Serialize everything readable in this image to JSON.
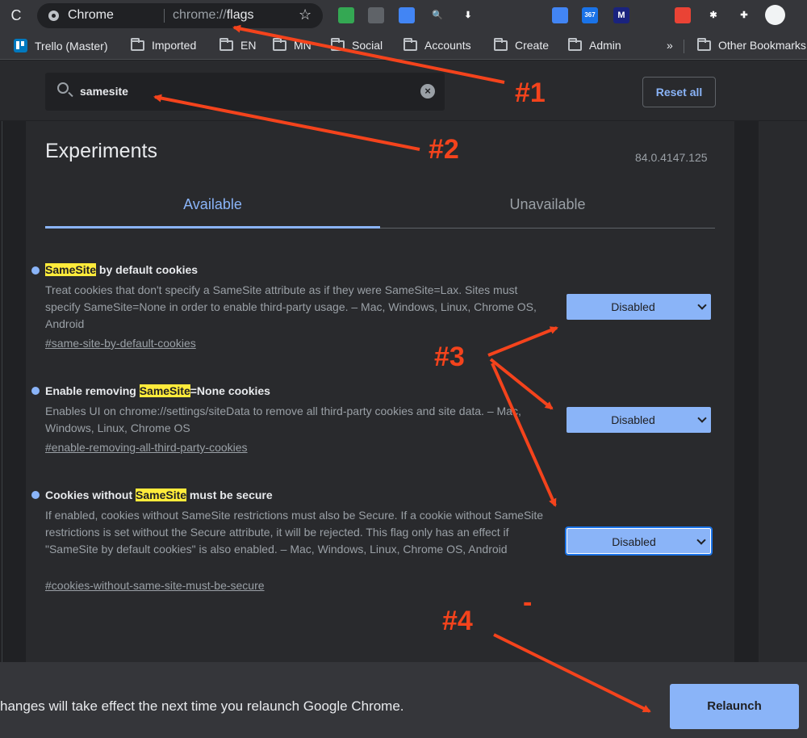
{
  "toolbar": {
    "reload_glyph": "C",
    "site_label": "Chrome",
    "url_prefix": "chrome://",
    "url_path": "flags",
    "extensions": [
      {
        "name": "ext-green-icon",
        "label": "",
        "color": "#34a853"
      },
      {
        "name": "ext-grid-icon",
        "label": "",
        "color": "#5f6368"
      },
      {
        "name": "ext-blue-icon",
        "label": "",
        "color": "#4285f4"
      },
      {
        "name": "ext-search-icon",
        "label": "",
        "color": "#35363a"
      },
      {
        "name": "ext-gray-icon",
        "label": "",
        "color": "#35363a"
      },
      {
        "name": "ext-dim-icon",
        "label": "",
        "color": "#35363a"
      },
      {
        "name": "ext-translate-icon",
        "label": "",
        "color": "#4285f4"
      },
      {
        "name": "ext-counter-icon",
        "label": "367",
        "color": "#1a73e8"
      },
      {
        "name": "ext-m-icon",
        "label": "M",
        "color": "#1a237e"
      },
      {
        "name": "ext-pen-icon",
        "label": "",
        "color": "#35363a"
      },
      {
        "name": "ext-red-icon",
        "label": "",
        "color": "#ea4335"
      },
      {
        "name": "ext-dots-icon",
        "label": "",
        "color": "#35363a"
      },
      {
        "name": "ext-puzzle-icon",
        "label": "",
        "color": "#35363a"
      }
    ]
  },
  "bookmarks": {
    "items": [
      "Trello (Master)",
      "Imported",
      "EN",
      "MN",
      "Social",
      "Accounts",
      "Create",
      "Admin"
    ],
    "overflow": "»",
    "other": "Other Bookmarks"
  },
  "flags": {
    "search_value": "samesite",
    "reset_label": "Reset all",
    "title": "Experiments",
    "version": "84.0.4147.125",
    "tabs": [
      "Available",
      "Unavailable"
    ],
    "items": [
      {
        "name_pre": "",
        "name_hl": "SameSite",
        "name_post": " by default cookies",
        "description": "Treat cookies that don't specify a SameSite attribute as if they were SameSite=Lax. Sites must specify SameSite=None in order to enable third-party usage. – Mac, Windows, Linux, Chrome OS, Android",
        "link": "#same-site-by-default-cookies",
        "value": "Disabled"
      },
      {
        "name_pre": "Enable removing ",
        "name_hl": "SameSite",
        "name_post": "=None cookies",
        "description": "Enables UI on chrome://settings/siteData to remove all third-party cookies and site data. – Mac, Windows, Linux, Chrome OS",
        "link": "#enable-removing-all-third-party-cookies",
        "value": "Disabled"
      },
      {
        "name_pre": "Cookies without ",
        "name_hl": "SameSite",
        "name_post": " must be secure",
        "description": "If enabled, cookies without SameSite restrictions must also be Secure. If a cookie without SameSite restrictions is set without the Secure attribute, it will be rejected. This flag only has an effect if \"SameSite by default cookies\" is also enabled. – Mac, Windows, Linux, Chrome OS, Android",
        "link": "#cookies-without-same-site-must-be-secure",
        "value": "Disabled"
      }
    ]
  },
  "bottom": {
    "message": "hanges will take effect the next time you relaunch Google Chrome.",
    "relaunch_label": "Relaunch"
  },
  "annotations": {
    "a1": "#1",
    "a2": "#2",
    "a3": "#3",
    "a4": "#4",
    "dash": "-",
    "color": "#f4431c"
  }
}
